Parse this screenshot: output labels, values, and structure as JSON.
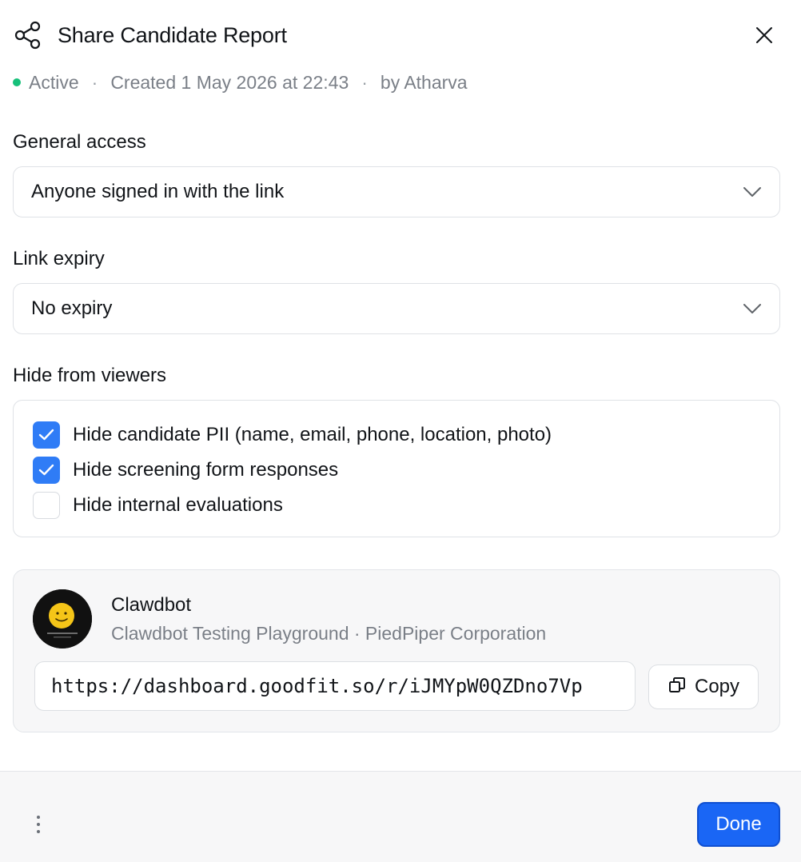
{
  "dialog": {
    "title": "Share Candidate Report",
    "status": "Active",
    "status_color": "#17c07a",
    "separator": "·",
    "created": "Created 1 May 2026 at 22:43",
    "author": "by Atharva",
    "close_icon": "close-icon",
    "share_icon": "share-icon"
  },
  "general_access": {
    "label": "General access",
    "value": "Anyone signed in with the link"
  },
  "link_expiry": {
    "label": "Link expiry",
    "value": "No expiry"
  },
  "hide_from_viewers": {
    "label": "Hide from viewers",
    "options": [
      {
        "label": "Hide candidate PII (name, email, phone, location, photo)",
        "checked": true
      },
      {
        "label": "Hide screening form responses",
        "checked": true
      },
      {
        "label": "Hide internal evaluations",
        "checked": false
      }
    ],
    "checked_color": "#2f7cf6"
  },
  "share_card": {
    "org_name": "Clawdbot",
    "org_subtitle": "Clawdbot Testing Playground · PiedPiper Corporation",
    "link": "https://dashboard.goodfit.so/r/iJMYpW0QZDno7Vp",
    "copy_label": "Copy",
    "copy_icon": "copy-icon"
  },
  "footer": {
    "more_icon": "more-vertical-icon",
    "done_label": "Done",
    "done_color": "#1a66f5"
  }
}
